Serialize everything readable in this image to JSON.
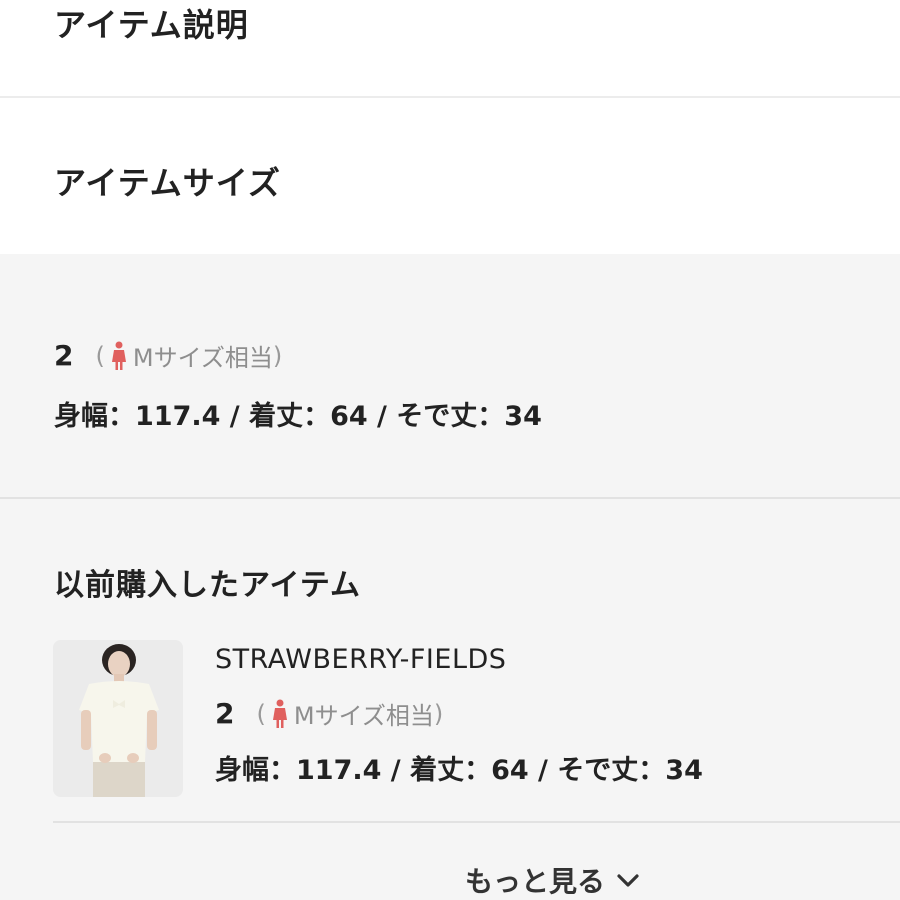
{
  "sections": {
    "description_title": "アイテム説明",
    "size_title": "アイテムサイズ",
    "previous_title": "以前購入したアイテム"
  },
  "current_size": {
    "size": "2",
    "paren_open": "(",
    "hint": "Mサイズ相当",
    "paren_close": ")",
    "measurements": "身幅：117.4 / 着丈：64 / そで丈：34"
  },
  "previous_item": {
    "brand": "STRAWBERRY-FIELDS",
    "size": "2",
    "paren_open": "(",
    "hint": "Mサイズ相当",
    "paren_close": ")",
    "measurements": "身幅：117.4 / 着丈：64 / そで丈：34"
  },
  "more": {
    "label": "もっと見る"
  },
  "icons": {
    "figure": "female-figure-icon",
    "chevron": "chevron-down-icon"
  },
  "colors": {
    "figure_icon": "#e0605e",
    "gray_background": "#f5f5f5"
  }
}
